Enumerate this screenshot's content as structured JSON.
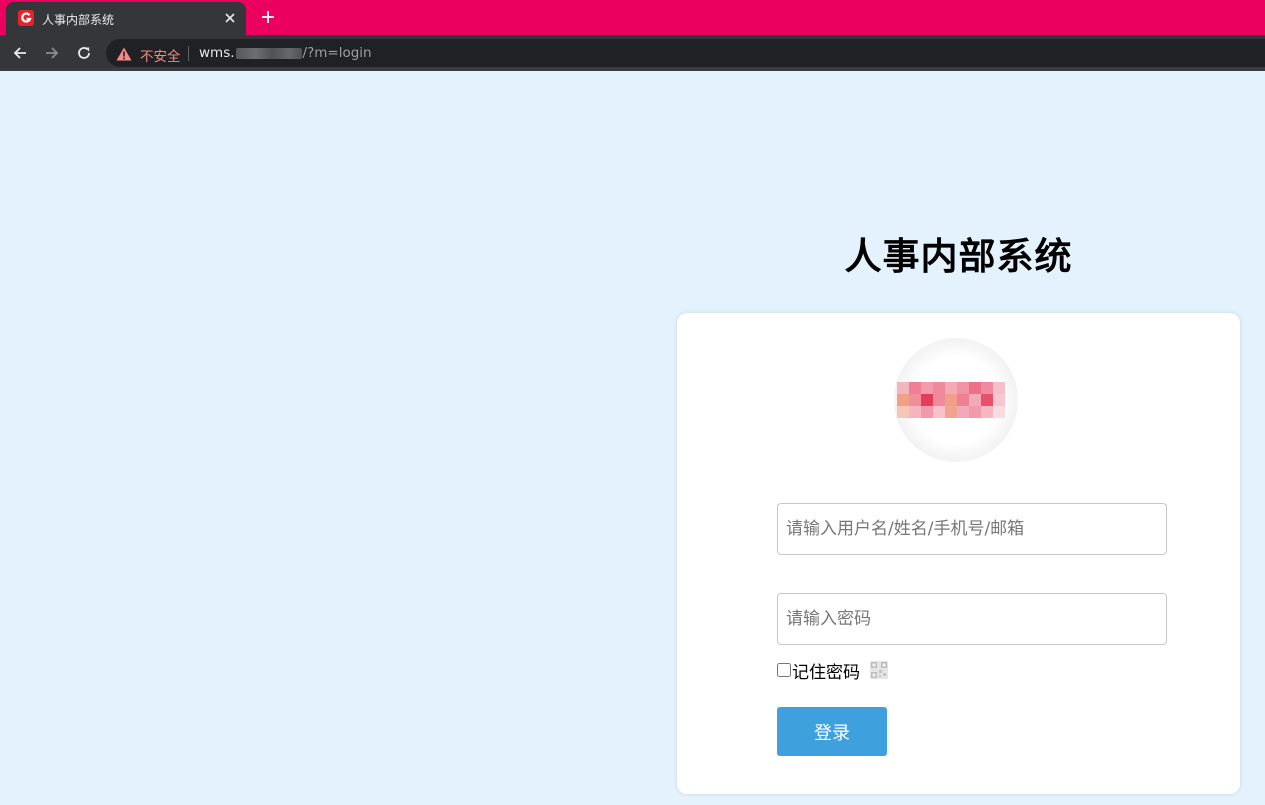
{
  "browser": {
    "tab": {
      "title": "人事内部系统"
    },
    "omnibox": {
      "security_label": "不安全",
      "url_host": "wms.",
      "url_path": "/?m=login"
    }
  },
  "page": {
    "title": "人事内部系统",
    "form": {
      "username_placeholder": "请输入用户名/姓名/手机号/邮箱",
      "password_placeholder": "请输入密码",
      "remember_label": "记住密码",
      "login_label": "登录"
    }
  },
  "colors": {
    "tabstrip": "#eb0060",
    "toolbar": "#35363a",
    "page_background": "#e3f2fc",
    "login_button": "#3fa0de"
  }
}
